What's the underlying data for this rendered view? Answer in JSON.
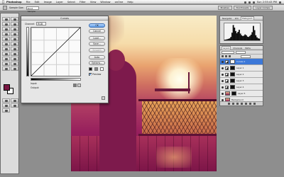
{
  "menubar": {
    "apple": "",
    "items": [
      "Photoshop",
      "File",
      "Edit",
      "Image",
      "Layer",
      "Select",
      "Filter",
      "View",
      "Window",
      "onOne",
      "Help"
    ],
    "clock": "Sun 2:55:43 PM"
  },
  "optbar": {
    "sample_label": "Sample Size:",
    "sample_value": "Point Sample",
    "tabs": [
      "Brushes",
      "Tool Presets",
      "Layer Comps"
    ]
  },
  "curves": {
    "title": "Curves",
    "channel_label": "Channel:",
    "channel_value": "RGB",
    "input_label": "Input:",
    "output_label": "Output:",
    "buttons": {
      "ok": "OK",
      "cancel": "Cancel",
      "load": "Load...",
      "save": "Save...",
      "smooth": "Smooth",
      "auto": "Auto",
      "options": "Options..."
    },
    "preview_label": "Preview",
    "preview_checked": true,
    "curve_points": [
      [
        0,
        0
      ],
      [
        1,
        1
      ]
    ]
  },
  "navigator": {
    "tabs": [
      "Navigator",
      "Info",
      "Histogram"
    ],
    "active_tab": "Histogram",
    "histogram_bins": [
      0.04,
      0.05,
      0.07,
      0.09,
      0.12,
      0.2,
      0.45,
      0.9,
      0.75,
      0.55,
      0.42,
      0.5,
      0.62,
      0.4,
      0.3,
      0.25,
      0.28,
      0.35,
      0.3,
      0.22,
      0.2,
      0.26,
      0.33,
      0.48,
      0.85,
      0.6,
      0.3,
      0.18,
      0.12,
      0.1
    ]
  },
  "layers": {
    "tabs": [
      "Layers",
      "Channels",
      "Paths"
    ],
    "items": [
      {
        "name": "Curves 1",
        "type": "adjustment",
        "mask": "white",
        "selected": true
      },
      {
        "name": "Layer 1",
        "type": "adjustment",
        "mask": "black",
        "selected": false
      },
      {
        "name": "Layer 2",
        "type": "adjustment",
        "mask": "black",
        "selected": false
      },
      {
        "name": "Layer 3",
        "type": "adjustment",
        "mask": "black",
        "selected": false
      },
      {
        "name": "Layer 4",
        "type": "adjustment",
        "mask": "black",
        "selected": false
      },
      {
        "name": "Layer 5",
        "type": "photo",
        "mask": "black",
        "selected": false
      },
      {
        "name": "Background",
        "type": "photo",
        "mask": "none",
        "selected": false
      }
    ]
  },
  "colors": {
    "foreground": "#7a1743",
    "background": "#ffffff",
    "accent": "#3c78d8"
  }
}
